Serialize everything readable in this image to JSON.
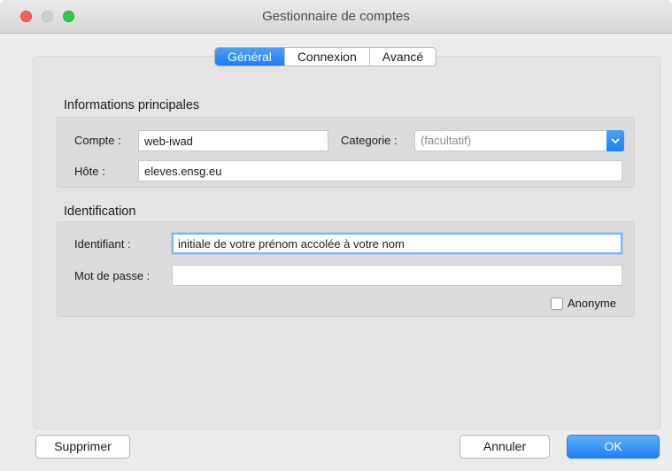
{
  "window": {
    "title": "Gestionnaire de comptes"
  },
  "tabs": [
    {
      "label": "Général",
      "active": true
    },
    {
      "label": "Connexion",
      "active": false
    },
    {
      "label": "Avancé",
      "active": false
    }
  ],
  "main_info": {
    "section_title": "Informations principales",
    "account_label": "Compte :",
    "account_value": "web-iwad",
    "category_label": "Categorie :",
    "category_value": "(facultatif)",
    "host_label": "Hôte :",
    "host_value": "eleves.ensg.eu"
  },
  "identification": {
    "section_title": "Identification",
    "username_label": "Identifiant :",
    "username_value": "initiale de votre prénom accolée à votre nom",
    "password_label": "Mot de passe :",
    "password_value": "",
    "anonymous_label": "Anonyme",
    "anonymous_checked": false
  },
  "buttons": {
    "delete": "Supprimer",
    "cancel": "Annuler",
    "ok": "OK"
  },
  "colors": {
    "accent": "#1f7ef0",
    "window_bg": "#ececec"
  },
  "icons": {
    "close": "close-icon",
    "minimize": "minimize-icon",
    "maximize": "maximize-icon",
    "dropdown": "chevron-down-icon"
  }
}
